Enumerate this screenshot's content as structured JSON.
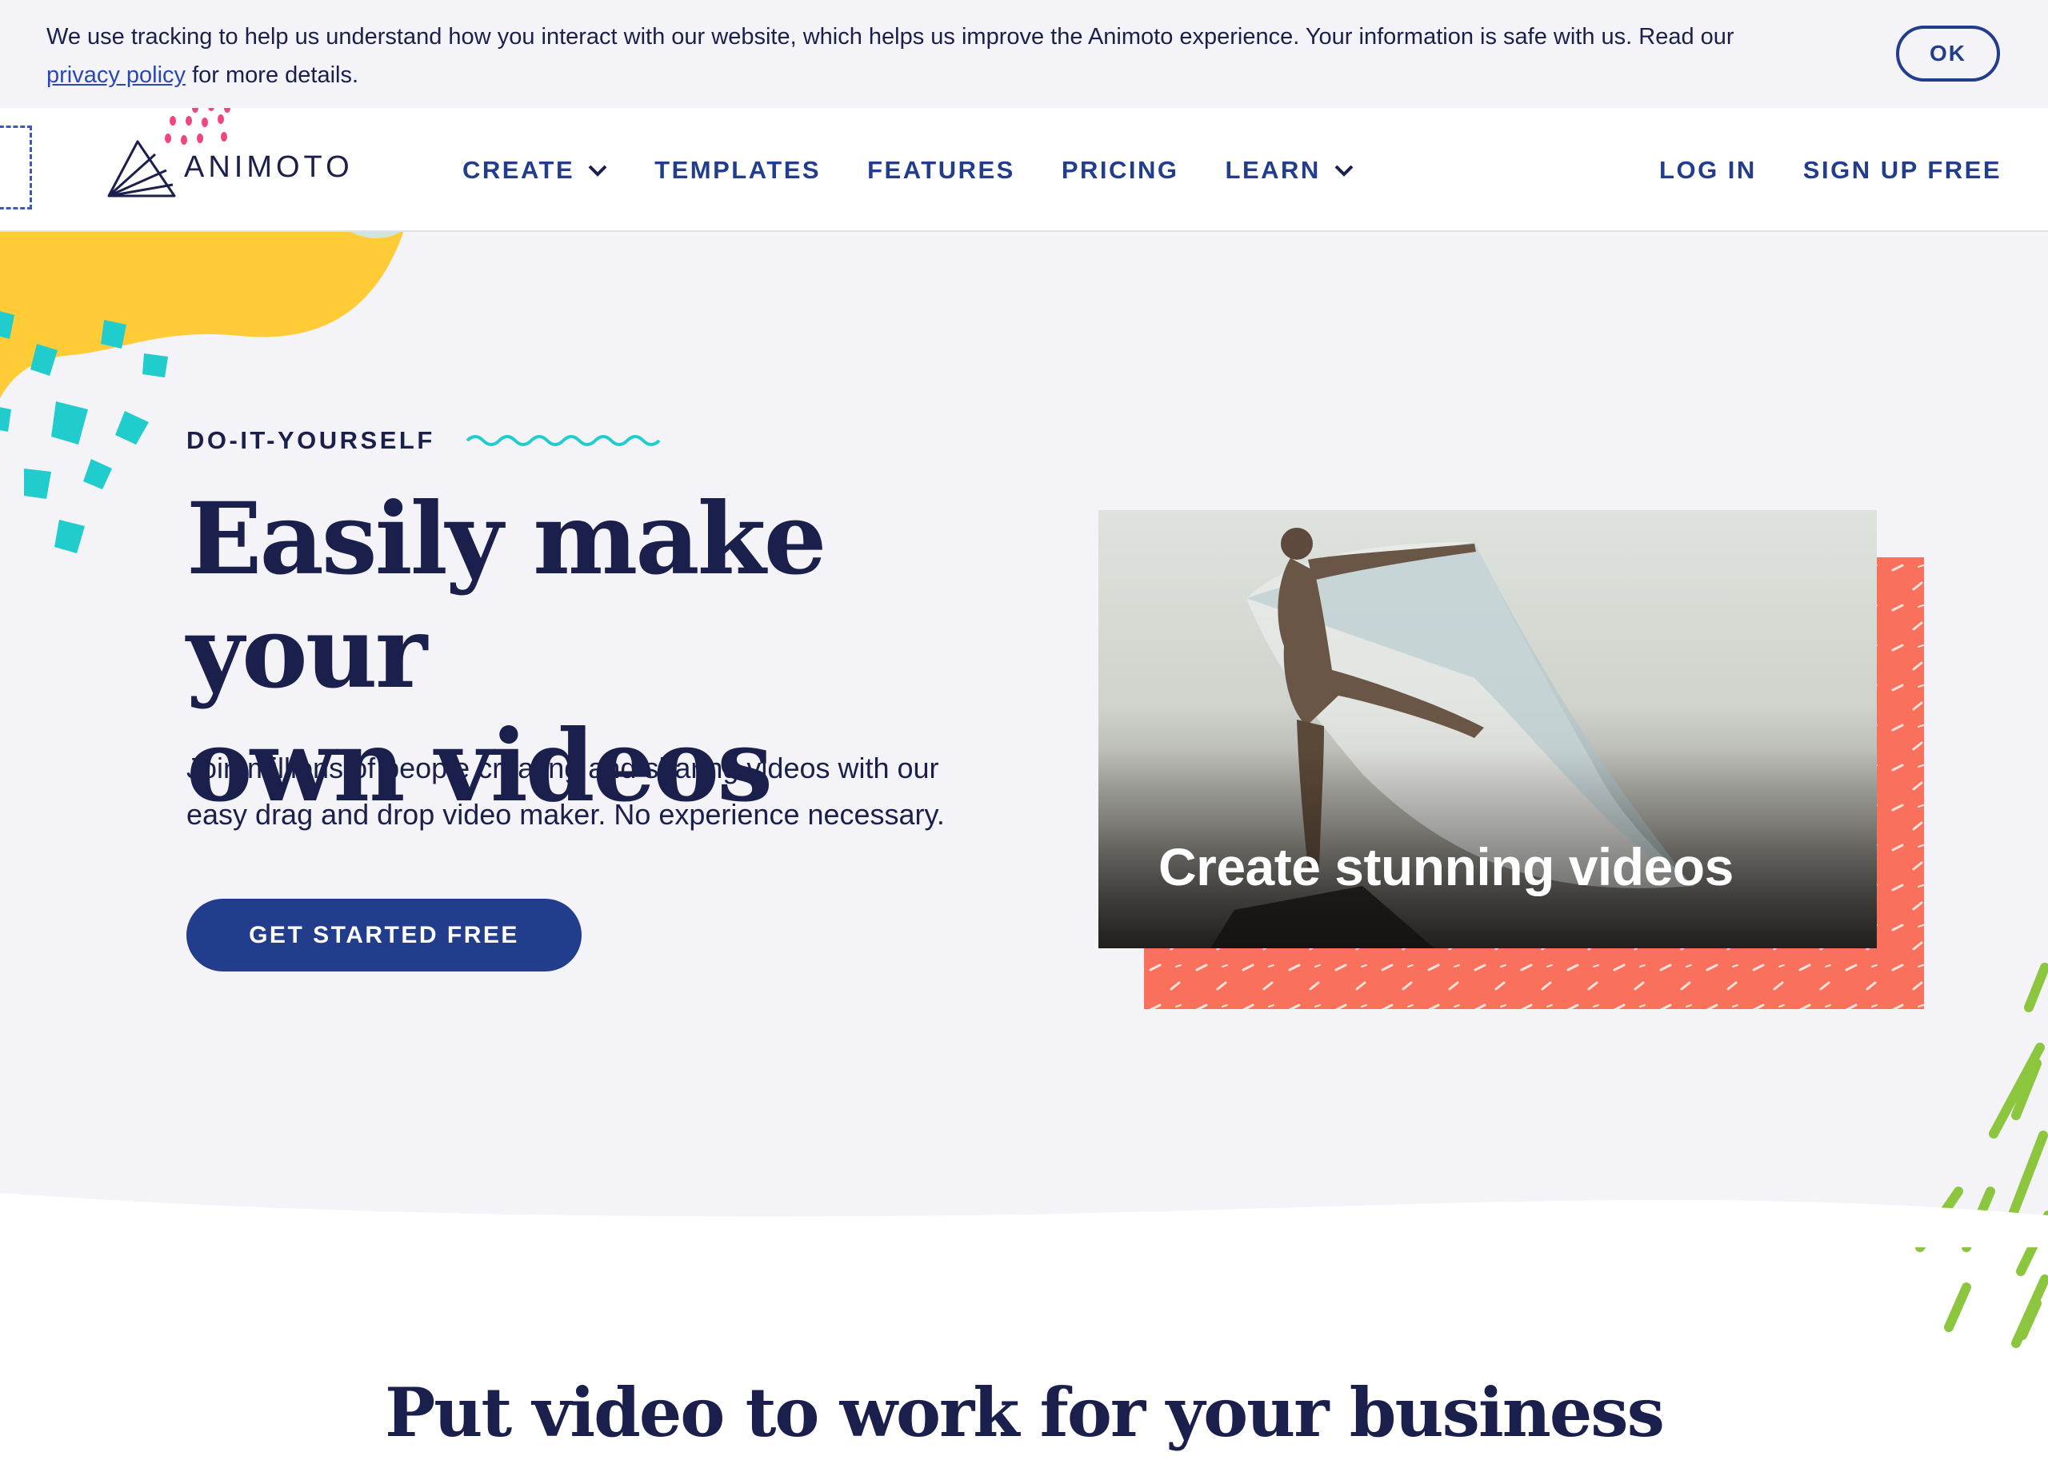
{
  "cookie_banner": {
    "text_before_link": "We use tracking to help us understand how you interact with our website, which helps us improve the Animoto experience. Your information is safe with us. Read our ",
    "link_text": "privacy policy",
    "text_after_link": " for more details.",
    "ok_label": "OK"
  },
  "header": {
    "logo_text": "ANIMOTO",
    "nav": {
      "create": "CREATE",
      "templates": "TEMPLATES",
      "features": "FEATURES",
      "pricing": "PRICING",
      "learn": "LEARN"
    },
    "login": "LOG IN",
    "signup": "SIGN UP FREE"
  },
  "hero": {
    "eyebrow": "DO-IT-YOURSELF",
    "headline_line1": "Easily make your",
    "headline_line2": "own videos",
    "subtext_line1": "Join millions of people creating and sharing videos with our",
    "subtext_line2": "easy drag and drop video maker. No experience necessary.",
    "cta": "GET STARTED FREE",
    "video_caption": "Create stunning videos"
  },
  "section": {
    "title": "Put video to work for your business"
  },
  "colors": {
    "navy": "#1b1f4b",
    "brand_blue": "#223d8b",
    "hero_bg": "#f3f3f8",
    "coral": "#f9705c",
    "yellow": "#ffcb37",
    "teal": "#21cccc",
    "green": "#8cc63f",
    "pink": "#f0457f"
  },
  "icons": {
    "chevron": "chevron-down-icon",
    "logo": "animoto-logo-icon",
    "wave": "squiggle-wave-icon"
  }
}
